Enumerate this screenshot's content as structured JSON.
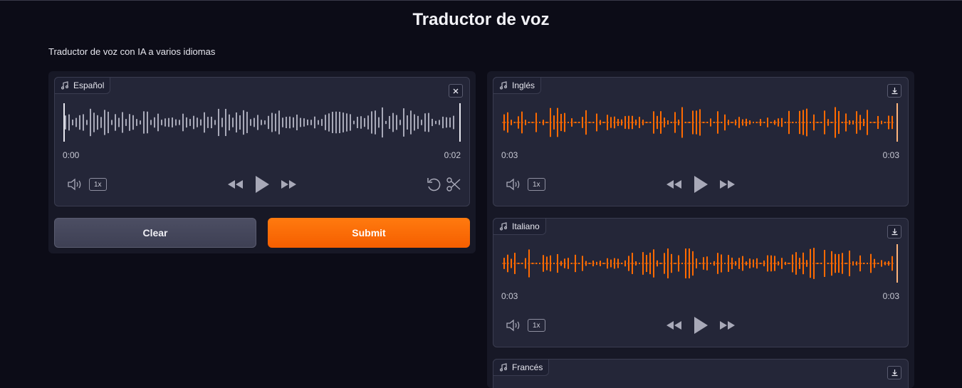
{
  "app": {
    "title": "Traductor de voz",
    "description": "Traductor de voz con IA a varios idiomas"
  },
  "input": {
    "label": "Español",
    "time_start": "0:00",
    "time_end": "0:02",
    "speed": "1x",
    "wave_color": "#a8a9b8"
  },
  "buttons": {
    "clear": "Clear",
    "submit": "Submit"
  },
  "outputs": [
    {
      "label": "Inglés",
      "time_start": "0:03",
      "time_end": "0:03",
      "speed": "1x"
    },
    {
      "label": "Italiano",
      "time_start": "0:03",
      "time_end": "0:03",
      "speed": "1x"
    },
    {
      "label": "Francés"
    }
  ],
  "colors": {
    "accent": "#ff6a00",
    "background": "#0c0c17",
    "panel": "#171826",
    "card": "#242638"
  },
  "icons": [
    "music-note-icon",
    "close-icon",
    "download-icon",
    "volume-icon",
    "rewind-icon",
    "play-icon",
    "fast-forward-icon",
    "undo-icon",
    "scissors-icon"
  ]
}
